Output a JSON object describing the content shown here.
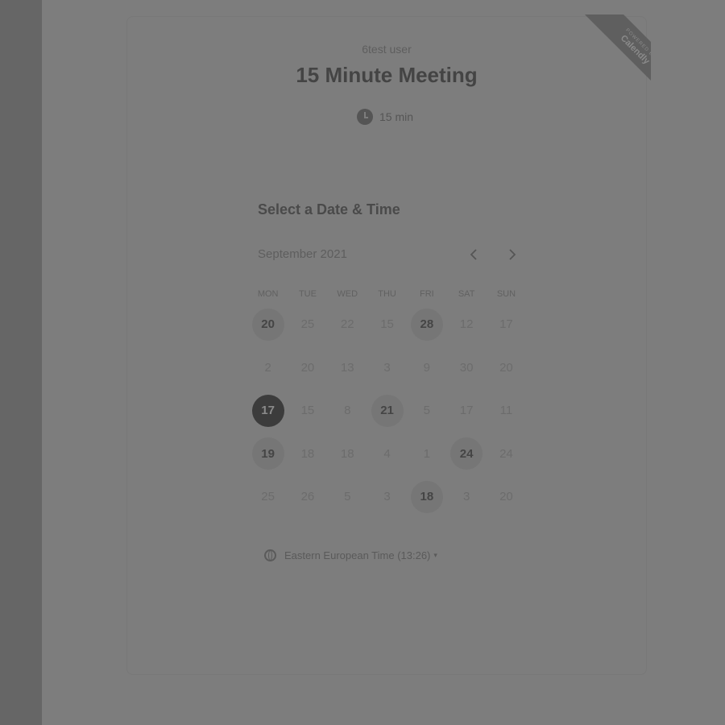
{
  "ribbon": {
    "line1": "POWERED BY",
    "brand": "Calendly"
  },
  "event": {
    "host": "6test user",
    "title": "15 Minute Meeting",
    "duration": "15 min"
  },
  "calendar": {
    "section_title": "Select a Date & Time",
    "month_label": "September 2021",
    "prev_icon": "chevron-left-icon",
    "next_icon": "chevron-right-icon",
    "weekdays": [
      "MON",
      "TUE",
      "WED",
      "THU",
      "FRI",
      "SAT",
      "SUN"
    ],
    "days": [
      {
        "label": "20",
        "state": "available"
      },
      {
        "label": "25",
        "state": "disabled"
      },
      {
        "label": "22",
        "state": "disabled"
      },
      {
        "label": "15",
        "state": "disabled"
      },
      {
        "label": "28",
        "state": "available"
      },
      {
        "label": "12",
        "state": "disabled"
      },
      {
        "label": "17",
        "state": "disabled"
      },
      {
        "label": "2",
        "state": "disabled"
      },
      {
        "label": "20",
        "state": "disabled"
      },
      {
        "label": "13",
        "state": "disabled"
      },
      {
        "label": "3",
        "state": "disabled"
      },
      {
        "label": "9",
        "state": "disabled"
      },
      {
        "label": "30",
        "state": "disabled"
      },
      {
        "label": "20",
        "state": "disabled"
      },
      {
        "label": "17",
        "state": "selected"
      },
      {
        "label": "15",
        "state": "disabled"
      },
      {
        "label": "8",
        "state": "disabled"
      },
      {
        "label": "21",
        "state": "available"
      },
      {
        "label": "5",
        "state": "disabled"
      },
      {
        "label": "17",
        "state": "disabled"
      },
      {
        "label": "11",
        "state": "disabled"
      },
      {
        "label": "19",
        "state": "available"
      },
      {
        "label": "18",
        "state": "disabled"
      },
      {
        "label": "18",
        "state": "disabled"
      },
      {
        "label": "4",
        "state": "disabled"
      },
      {
        "label": "1",
        "state": "disabled"
      },
      {
        "label": "24",
        "state": "available"
      },
      {
        "label": "24",
        "state": "disabled"
      },
      {
        "label": "25",
        "state": "disabled"
      },
      {
        "label": "26",
        "state": "disabled"
      },
      {
        "label": "5",
        "state": "disabled"
      },
      {
        "label": "3",
        "state": "disabled"
      },
      {
        "label": "18",
        "state": "available"
      },
      {
        "label": "3",
        "state": "disabled"
      },
      {
        "label": "20",
        "state": "disabled"
      }
    ]
  },
  "timezone": {
    "label": "Eastern European Time (13:26)",
    "icon": "globe-icon",
    "caret": "▾"
  },
  "colors": {
    "overlay_background": "#7d7d7d",
    "selected_day": "#3c3c3c",
    "available_day": "#767676"
  }
}
